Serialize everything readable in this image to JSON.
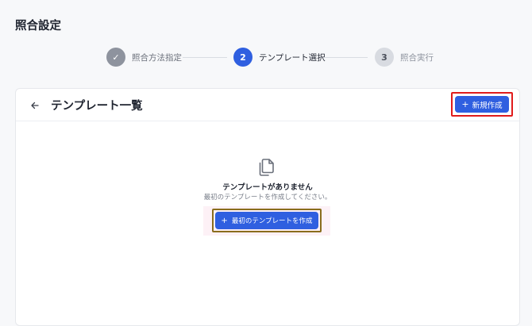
{
  "page": {
    "title": "照合設定"
  },
  "stepper": {
    "steps": [
      {
        "marker": "✓",
        "label": "照合方法指定",
        "state": "completed"
      },
      {
        "marker": "2",
        "label": "テンプレート選択",
        "state": "active"
      },
      {
        "marker": "3",
        "label": "照合実行",
        "state": "pending"
      }
    ]
  },
  "card": {
    "title": "テンプレート一覧",
    "back_icon": "arrow-left-icon",
    "new_button": {
      "icon": "+",
      "label": "新規作成"
    }
  },
  "empty_state": {
    "icon": "documents-icon",
    "title": "テンプレートがありません",
    "description": "最初のテンプレートを作成してください。",
    "create_button": {
      "icon": "+",
      "label": "最初のテンプレートを作成"
    }
  },
  "colors": {
    "accent": "#2f5fe0",
    "completed_step": "#8e939e",
    "pending_step": "#d8dbe1",
    "highlight_red": "#e01b1b",
    "highlight_olive": "#8a6d1d"
  }
}
